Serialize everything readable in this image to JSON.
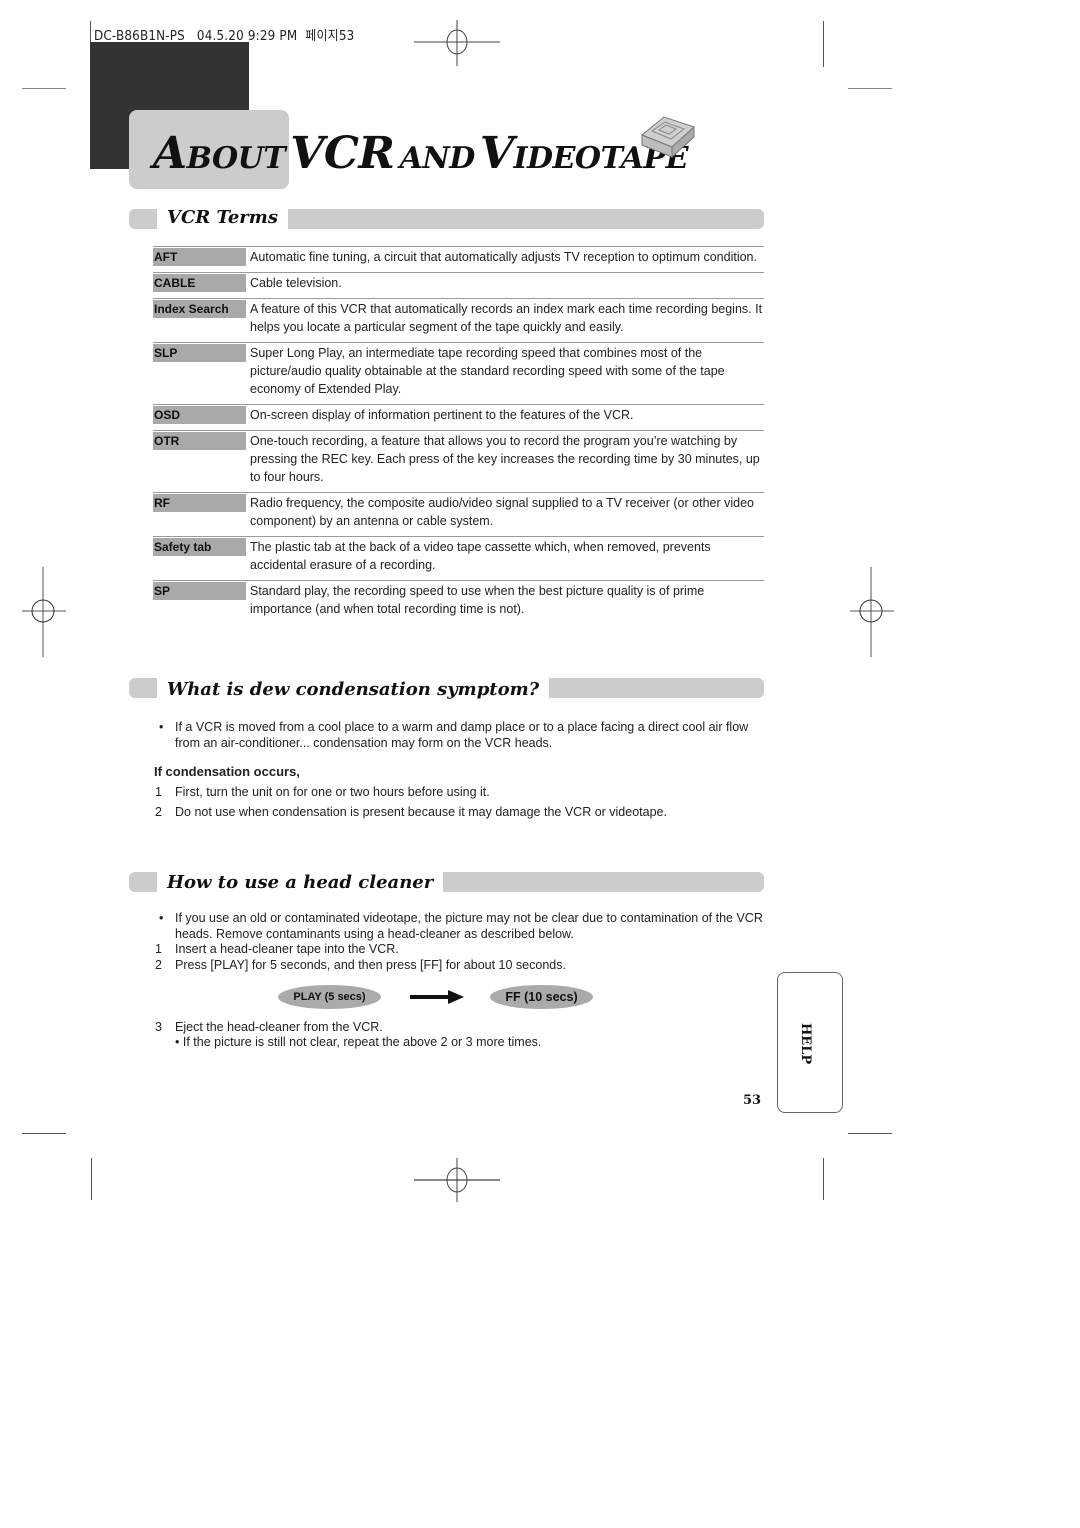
{
  "slug": "DC-B86B1N-PS   04.5.20 9:29 PM  페이지53",
  "title": {
    "word1_cap": "A",
    "word1_rest": "BOUT",
    "word2": "VCR",
    "word3": "AND",
    "word4_cap": "V",
    "word4_rest": "IDEOTAPE",
    "icon": "videotape-icon"
  },
  "sections": {
    "vcr_terms": {
      "heading": "VCR Terms",
      "terms": [
        {
          "label": "AFT",
          "desc": "Automatic fine tuning, a circuit that automatically adjusts TV reception to optimum condition."
        },
        {
          "label": "CABLE",
          "desc": "Cable television."
        },
        {
          "label": "Index Search",
          "desc": "A feature of this VCR that automatically records an index mark each time recording begins. It helps you locate a particular segment of the tape quickly and easily."
        },
        {
          "label": "SLP",
          "desc": "Super Long Play, an intermediate tape recording speed that combines most of the picture/audio quality obtainable at the standard recording speed with some of the tape economy of Extended Play."
        },
        {
          "label": "OSD",
          "desc": "On-screen display of information pertinent to the features of the VCR."
        },
        {
          "label": "OTR",
          "desc": "One-touch recording, a feature that allows you to record the program you’re watching by pressing the REC key. Each press of the key increases the recording time by 30 minutes, up to four hours."
        },
        {
          "label": "RF",
          "desc": "Radio frequency, the composite audio/video signal supplied to a TV receiver (or other video component) by an antenna or cable system."
        },
        {
          "label": "Safety tab",
          "desc": "The plastic tab at the back of a video tape cassette which, when removed, prevents accidental erasure of a recording."
        },
        {
          "label": "SP",
          "desc": "Standard play, the recording speed to use when the best picture quality is of prime importance (and when total recording time is not)."
        }
      ]
    },
    "dew": {
      "heading": "What is dew condensation symptom?",
      "bullet": "If a VCR is moved from a cool place to a warm and damp place or to a place facing a direct cool air flow from an air-conditioner... condensation may form on the VCR heads.",
      "subheading": "If condensation occurs,",
      "steps": [
        {
          "num": "1",
          "text": "First, turn the unit on for one or two hours before using it."
        },
        {
          "num": "2",
          "text": "Do not use when condensation is present because it may damage the VCR or videotape."
        }
      ]
    },
    "head_cleaner": {
      "heading": "How to use a head cleaner",
      "bullet": "If you use an old or contaminated videotape, the picture may not be clear due to contamination of the VCR heads. Remove contaminants using a head-cleaner as described below.",
      "steps": [
        {
          "num": "1",
          "text": "Insert a head-cleaner tape into the VCR."
        },
        {
          "num": "2",
          "text": "Press [PLAY] for 5 seconds, and then press [FF] for about 10 seconds."
        },
        {
          "num": "3",
          "text": "Eject the head-cleaner from the VCR."
        }
      ],
      "flow": {
        "from": "PLAY (5 secs)",
        "to": "FF (10 secs)",
        "arrow": "right-arrow-icon"
      },
      "sub_bullet": "If the picture is still not clear, repeat the above 2 or 3 more times."
    }
  },
  "side_tab": "HELP",
  "page_number": "53",
  "colors": {
    "dark_block": "#333333",
    "light_gray": "#cccccc",
    "label_gray": "#a9a9a9",
    "pill_gray": "#aaaaaa"
  }
}
